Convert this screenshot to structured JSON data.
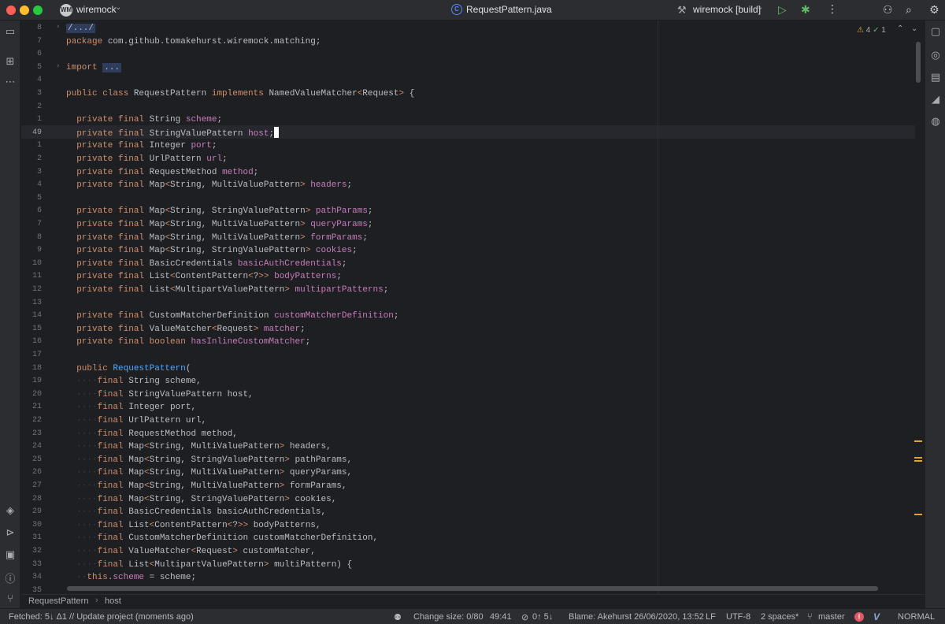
{
  "titlebar": {
    "project_badge": "WM",
    "project_name": "wiremock",
    "file_name": "RequestPattern.java",
    "run_config": "wiremock [build]",
    "icons": [
      "chevron-down-icon",
      "java-class-icon",
      "hammer-icon",
      "run-icon",
      "debug-icon",
      "more-icon",
      "add-user-icon",
      "search-icon",
      "gear-icon"
    ]
  },
  "editor": {
    "inspection": {
      "warnings": "4",
      "ok": "1"
    },
    "current_line": "49",
    "lines": [
      {
        "n": "8",
        "fold": "›",
        "parts": [
          [
            "fb",
            "/.../"
          ]
        ]
      },
      {
        "n": "7",
        "parts": [
          [
            "kw",
            "package"
          ],
          [
            "",
            " com.github.tomakehurst.wiremock.matching;"
          ]
        ]
      },
      {
        "n": "6",
        "parts": []
      },
      {
        "n": "5",
        "fold": "›",
        "parts": [
          [
            "kw",
            "import"
          ],
          [
            "",
            " "
          ],
          [
            "fb",
            "..."
          ]
        ]
      },
      {
        "n": "4",
        "parts": []
      },
      {
        "n": "3",
        "parts": [
          [
            "kw",
            "public class"
          ],
          [
            "",
            " RequestPattern "
          ],
          [
            "kw",
            "implements"
          ],
          [
            "",
            " NamedValueMatcher"
          ],
          [
            "gen",
            "<"
          ],
          [
            "",
            "Request"
          ],
          [
            "gen",
            ">"
          ],
          [
            "",
            " {"
          ]
        ]
      },
      {
        "n": "2",
        "parts": []
      },
      {
        "n": "1",
        "parts": [
          [
            "",
            "  "
          ],
          [
            "kw",
            "private final"
          ],
          [
            "",
            " String "
          ],
          [
            "fld",
            "scheme"
          ],
          [
            "",
            ";"
          ]
        ]
      },
      {
        "n": "49",
        "parts": [
          [
            "",
            "  "
          ],
          [
            "kw",
            "private final"
          ],
          [
            "",
            " StringValuePattern "
          ],
          [
            "fld",
            "host"
          ],
          [
            "",
            ";"
          ],
          [
            "caret",
            ""
          ]
        ]
      },
      {
        "n": "1",
        "parts": [
          [
            "",
            "  "
          ],
          [
            "kw",
            "private final"
          ],
          [
            "",
            " Integer "
          ],
          [
            "fld",
            "port"
          ],
          [
            "",
            ";"
          ]
        ]
      },
      {
        "n": "2",
        "parts": [
          [
            "",
            "  "
          ],
          [
            "kw",
            "private final"
          ],
          [
            "",
            " UrlPattern "
          ],
          [
            "fld",
            "url"
          ],
          [
            "",
            ";"
          ]
        ]
      },
      {
        "n": "3",
        "parts": [
          [
            "",
            "  "
          ],
          [
            "kw",
            "private final"
          ],
          [
            "",
            " RequestMethod "
          ],
          [
            "fld",
            "method"
          ],
          [
            "",
            ";"
          ]
        ]
      },
      {
        "n": "4",
        "parts": [
          [
            "",
            "  "
          ],
          [
            "kw",
            "private final"
          ],
          [
            "",
            " Map"
          ],
          [
            "gen",
            "<"
          ],
          [
            "",
            "String, MultiValuePattern"
          ],
          [
            "gen",
            ">"
          ],
          [
            "",
            " "
          ],
          [
            "fld",
            "headers"
          ],
          [
            "",
            ";"
          ]
        ]
      },
      {
        "n": "5",
        "parts": []
      },
      {
        "n": "6",
        "parts": [
          [
            "",
            "  "
          ],
          [
            "kw",
            "private final"
          ],
          [
            "",
            " Map"
          ],
          [
            "gen",
            "<"
          ],
          [
            "",
            "String, StringValuePattern"
          ],
          [
            "gen",
            ">"
          ],
          [
            "",
            " "
          ],
          [
            "fld",
            "pathParams"
          ],
          [
            "",
            ";"
          ]
        ]
      },
      {
        "n": "7",
        "parts": [
          [
            "",
            "  "
          ],
          [
            "kw",
            "private final"
          ],
          [
            "",
            " Map"
          ],
          [
            "gen",
            "<"
          ],
          [
            "",
            "String, MultiValuePattern"
          ],
          [
            "gen",
            ">"
          ],
          [
            "",
            " "
          ],
          [
            "fld",
            "queryParams"
          ],
          [
            "",
            ";"
          ]
        ]
      },
      {
        "n": "8",
        "parts": [
          [
            "",
            "  "
          ],
          [
            "kw",
            "private final"
          ],
          [
            "",
            " Map"
          ],
          [
            "gen",
            "<"
          ],
          [
            "",
            "String, MultiValuePattern"
          ],
          [
            "gen",
            ">"
          ],
          [
            "",
            " "
          ],
          [
            "fld",
            "formParams"
          ],
          [
            "",
            ";"
          ]
        ]
      },
      {
        "n": "9",
        "parts": [
          [
            "",
            "  "
          ],
          [
            "kw",
            "private final"
          ],
          [
            "",
            " Map"
          ],
          [
            "gen",
            "<"
          ],
          [
            "",
            "String, StringValuePattern"
          ],
          [
            "gen",
            ">"
          ],
          [
            "",
            " "
          ],
          [
            "fld",
            "cookies"
          ],
          [
            "",
            ";"
          ]
        ]
      },
      {
        "n": "10",
        "parts": [
          [
            "",
            "  "
          ],
          [
            "kw",
            "private final"
          ],
          [
            "",
            " BasicCredentials "
          ],
          [
            "fld",
            "basicAuthCredentials"
          ],
          [
            "",
            ";"
          ]
        ]
      },
      {
        "n": "11",
        "parts": [
          [
            "",
            "  "
          ],
          [
            "kw",
            "private final"
          ],
          [
            "",
            " List"
          ],
          [
            "gen",
            "<"
          ],
          [
            "",
            "ContentPattern"
          ],
          [
            "gen",
            "<"
          ],
          [
            "",
            "?"
          ],
          [
            "gen",
            ">>"
          ],
          [
            "",
            " "
          ],
          [
            "fld",
            "bodyPatterns"
          ],
          [
            "",
            ";"
          ]
        ]
      },
      {
        "n": "12",
        "parts": [
          [
            "",
            "  "
          ],
          [
            "kw",
            "private final"
          ],
          [
            "",
            " List"
          ],
          [
            "gen",
            "<"
          ],
          [
            "",
            "MultipartValuePattern"
          ],
          [
            "gen",
            ">"
          ],
          [
            "",
            " "
          ],
          [
            "fld",
            "multipartPatterns"
          ],
          [
            "",
            ";"
          ]
        ]
      },
      {
        "n": "13",
        "parts": []
      },
      {
        "n": "14",
        "parts": [
          [
            "",
            "  "
          ],
          [
            "kw",
            "private final"
          ],
          [
            "",
            " CustomMatcherDefinition "
          ],
          [
            "fld",
            "customMatcherDefinition"
          ],
          [
            "",
            ";"
          ]
        ]
      },
      {
        "n": "15",
        "parts": [
          [
            "",
            "  "
          ],
          [
            "kw",
            "private final"
          ],
          [
            "",
            " ValueMatcher"
          ],
          [
            "gen",
            "<"
          ],
          [
            "",
            "Request"
          ],
          [
            "gen",
            ">"
          ],
          [
            "",
            " "
          ],
          [
            "fld",
            "matcher"
          ],
          [
            "",
            ";"
          ]
        ]
      },
      {
        "n": "16",
        "parts": [
          [
            "",
            "  "
          ],
          [
            "kw",
            "private final boolean"
          ],
          [
            "",
            " "
          ],
          [
            "fld",
            "hasInlineCustomMatcher"
          ],
          [
            "",
            ";"
          ]
        ]
      },
      {
        "n": "17",
        "parts": []
      },
      {
        "n": "18",
        "parts": [
          [
            "",
            "  "
          ],
          [
            "kw",
            "public"
          ],
          [
            "",
            " "
          ],
          [
            "mth",
            "RequestPattern"
          ],
          [
            "",
            "("
          ]
        ]
      },
      {
        "n": "19",
        "parts": [
          [
            "dot",
            "  ····"
          ],
          [
            "kw",
            "final"
          ],
          [
            "",
            " String scheme,"
          ]
        ]
      },
      {
        "n": "20",
        "parts": [
          [
            "dot",
            "  ····"
          ],
          [
            "kw",
            "final"
          ],
          [
            "",
            " StringValuePattern host,"
          ]
        ]
      },
      {
        "n": "21",
        "parts": [
          [
            "dot",
            "  ····"
          ],
          [
            "kw",
            "final"
          ],
          [
            "",
            " Integer port,"
          ]
        ]
      },
      {
        "n": "22",
        "parts": [
          [
            "dot",
            "  ····"
          ],
          [
            "kw",
            "final"
          ],
          [
            "",
            " UrlPattern url,"
          ]
        ]
      },
      {
        "n": "23",
        "parts": [
          [
            "dot",
            "  ····"
          ],
          [
            "kw",
            "final"
          ],
          [
            "",
            " RequestMethod method,"
          ]
        ]
      },
      {
        "n": "24",
        "parts": [
          [
            "dot",
            "  ····"
          ],
          [
            "kw",
            "final"
          ],
          [
            "",
            " Map"
          ],
          [
            "gen",
            "<"
          ],
          [
            "",
            "String, MultiValuePattern"
          ],
          [
            "gen",
            ">"
          ],
          [
            "",
            " headers,"
          ]
        ]
      },
      {
        "n": "25",
        "parts": [
          [
            "dot",
            "  ····"
          ],
          [
            "kw",
            "final"
          ],
          [
            "",
            " Map"
          ],
          [
            "gen",
            "<"
          ],
          [
            "",
            "String, StringValuePattern"
          ],
          [
            "gen",
            ">"
          ],
          [
            "",
            " pathParams,"
          ]
        ]
      },
      {
        "n": "26",
        "parts": [
          [
            "dot",
            "  ····"
          ],
          [
            "kw",
            "final"
          ],
          [
            "",
            " Map"
          ],
          [
            "gen",
            "<"
          ],
          [
            "",
            "String, MultiValuePattern"
          ],
          [
            "gen",
            ">"
          ],
          [
            "",
            " queryParams,"
          ]
        ]
      },
      {
        "n": "27",
        "parts": [
          [
            "dot",
            "  ····"
          ],
          [
            "kw",
            "final"
          ],
          [
            "",
            " Map"
          ],
          [
            "gen",
            "<"
          ],
          [
            "",
            "String, MultiValuePattern"
          ],
          [
            "gen",
            ">"
          ],
          [
            "",
            " formParams,"
          ]
        ]
      },
      {
        "n": "28",
        "parts": [
          [
            "dot",
            "  ····"
          ],
          [
            "kw",
            "final"
          ],
          [
            "",
            " Map"
          ],
          [
            "gen",
            "<"
          ],
          [
            "",
            "String, StringValuePattern"
          ],
          [
            "gen",
            ">"
          ],
          [
            "",
            " cookies,"
          ]
        ]
      },
      {
        "n": "29",
        "parts": [
          [
            "dot",
            "  ····"
          ],
          [
            "kw",
            "final"
          ],
          [
            "",
            " BasicCredentials basicAuthCredentials,"
          ]
        ]
      },
      {
        "n": "30",
        "parts": [
          [
            "dot",
            "  ····"
          ],
          [
            "kw",
            "final"
          ],
          [
            "",
            " List"
          ],
          [
            "gen",
            "<"
          ],
          [
            "",
            "ContentPattern"
          ],
          [
            "gen",
            "<"
          ],
          [
            "",
            "?"
          ],
          [
            "gen",
            ">>"
          ],
          [
            "",
            " bodyPatterns,"
          ]
        ]
      },
      {
        "n": "31",
        "parts": [
          [
            "dot",
            "  ····"
          ],
          [
            "kw",
            "final"
          ],
          [
            "",
            " CustomMatcherDefinition customMatcherDefinition,"
          ]
        ]
      },
      {
        "n": "32",
        "parts": [
          [
            "dot",
            "  ····"
          ],
          [
            "kw",
            "final"
          ],
          [
            "",
            " ValueMatcher"
          ],
          [
            "gen",
            "<"
          ],
          [
            "",
            "Request"
          ],
          [
            "gen",
            ">"
          ],
          [
            "",
            " customMatcher,"
          ]
        ]
      },
      {
        "n": "33",
        "parts": [
          [
            "dot",
            "  ····"
          ],
          [
            "kw",
            "final"
          ],
          [
            "",
            " List"
          ],
          [
            "gen",
            "<"
          ],
          [
            "",
            "MultipartValuePattern"
          ],
          [
            "gen",
            ">"
          ],
          [
            "",
            " multiPattern) {"
          ]
        ]
      },
      {
        "n": "34",
        "parts": [
          [
            "dot",
            "  ··"
          ],
          [
            "kw",
            "this"
          ],
          [
            "",
            "."
          ],
          [
            "fld",
            "scheme"
          ],
          [
            "",
            " = scheme;"
          ]
        ]
      },
      {
        "n": "35",
        "parts": []
      }
    ]
  },
  "breadcrumb": {
    "class_name": "RequestPattern",
    "member": "host",
    "separator": "›"
  },
  "status": {
    "fetched": "Fetched: 5↓ Δ1 // Update project (moments ago)",
    "change_size": "Change size: 0/80",
    "position": "49:41",
    "git_counts": "0↑ 5↓",
    "blame": "Blame: Akehurst 26/06/2020, 13:52",
    "line_ending": "LF",
    "encoding": "UTF-8",
    "indent": "2 spaces*",
    "branch": "master",
    "mode": "NORMAL"
  },
  "colors": {
    "keyword": "#cf8e6d",
    "field": "#c77dbb",
    "method": "#56a8f5",
    "text": "#bcbec4",
    "warning": "#e0a23a"
  }
}
